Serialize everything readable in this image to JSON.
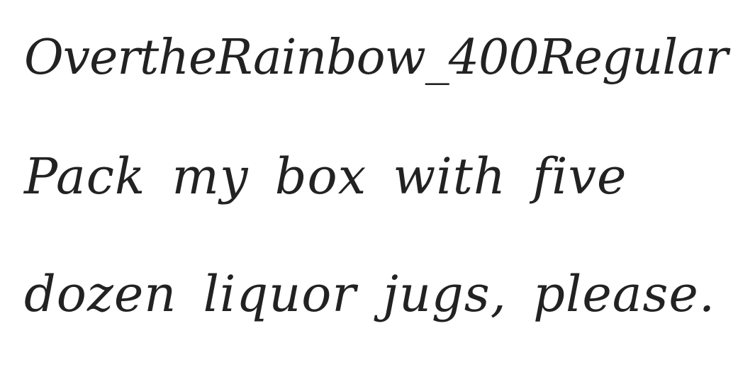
{
  "font_preview": {
    "font_name": "OvertheRainbow_400Regular",
    "sample_line_1": "Pack my box with five",
    "sample_line_2": "dozen liquor jugs, please.",
    "text_color": "#222222",
    "background_color": "#ffffff"
  }
}
